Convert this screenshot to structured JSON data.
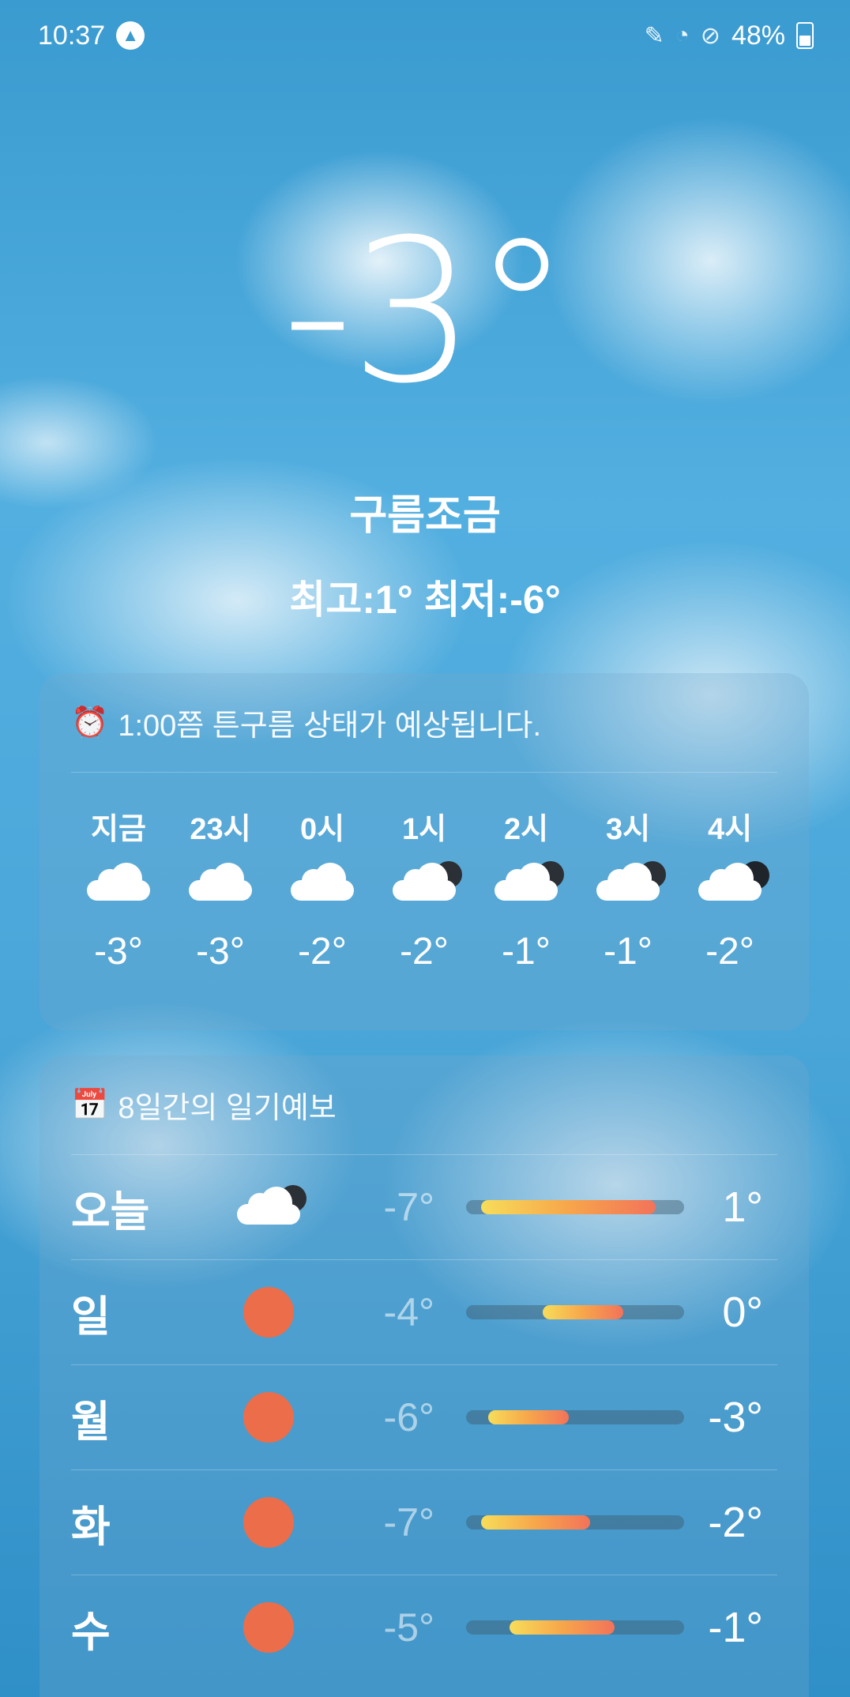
{
  "status_bar": {
    "time": "10:37",
    "battery": "48%",
    "icons": [
      "app-badge-icon",
      "pen-icon",
      "wifi-icon",
      "do-not-disturb-icon",
      "battery-icon"
    ]
  },
  "current": {
    "temperature": "-3°",
    "condition": "구름조금",
    "hi_lo": "최고:1° 최저:-6°"
  },
  "hourly": {
    "header_icon": "alarm-clock-icon",
    "header_text": "1:00쯤 튼구름 상태가 예상됩니다.",
    "items": [
      {
        "label": "지금",
        "icon": "cloud-icon",
        "temp": "-3°"
      },
      {
        "label": "23시",
        "icon": "cloud-icon",
        "temp": "-3°"
      },
      {
        "label": "0시",
        "icon": "cloud-icon",
        "temp": "-2°"
      },
      {
        "label": "1시",
        "icon": "cloud-dark-icon",
        "temp": "-2°"
      },
      {
        "label": "2시",
        "icon": "cloud-dark-icon",
        "temp": "-1°"
      },
      {
        "label": "3시",
        "icon": "cloud-dark-icon",
        "temp": "-1°"
      },
      {
        "label": "4시",
        "icon": "cloud-moon-icon",
        "temp": "-2°"
      }
    ]
  },
  "daily": {
    "header_icon": "calendar-icon",
    "header_text": "8일간의 일기예보",
    "items": [
      {
        "day": "오늘",
        "icon": "cloud-dark-icon",
        "low": "-7°",
        "high": "1°",
        "range_start": 0.07,
        "range_end": 0.87
      },
      {
        "day": "일",
        "icon": "sun-icon",
        "low": "-4°",
        "high": "0°",
        "range_start": 0.35,
        "range_end": 0.72
      },
      {
        "day": "월",
        "icon": "sun-icon",
        "low": "-6°",
        "high": "-3°",
        "range_start": 0.1,
        "range_end": 0.47
      },
      {
        "day": "화",
        "icon": "sun-icon",
        "low": "-7°",
        "high": "-2°",
        "range_start": 0.07,
        "range_end": 0.57
      },
      {
        "day": "수",
        "icon": "sun-icon",
        "low": "-5°",
        "high": "-1°",
        "range_start": 0.2,
        "range_end": 0.68
      }
    ]
  }
}
